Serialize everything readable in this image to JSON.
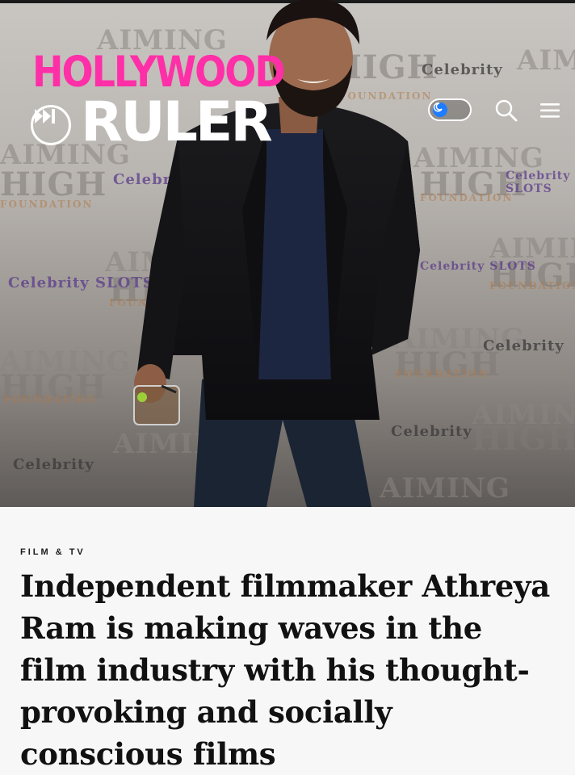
{
  "site": {
    "logo_top": "HOLLYWOOD",
    "logo_bottom": "RULER"
  },
  "hero": {
    "backdrop_words": [
      "AIMING",
      "HIGH",
      "FOUNDATION",
      "Celebrity",
      "Celebrity SLOTS"
    ]
  },
  "header": {
    "icons": [
      "moon-icon",
      "search-icon",
      "hamburger-menu-icon"
    ]
  },
  "article": {
    "category": "FILM & TV",
    "headline": "Independent filmmaker Athreya Ram is making waves in the film industry with his thought-provoking and socially conscious films"
  },
  "colors": {
    "brand_pink": "#ff2fa8",
    "toggle_blue": "#1e7cff",
    "text_dark": "#111111",
    "page_bg": "#f7f7f8"
  }
}
